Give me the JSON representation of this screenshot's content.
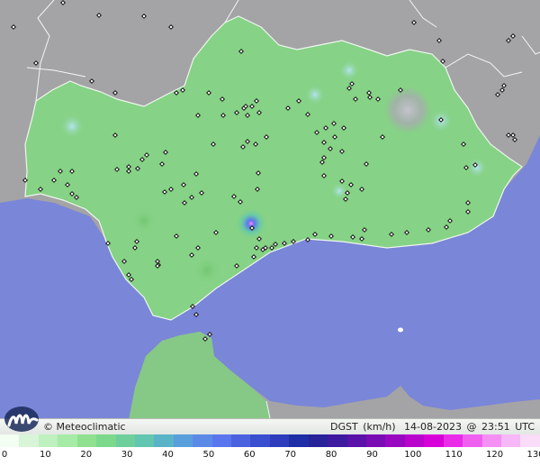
{
  "brand": {
    "copyright_symbol": "©",
    "name": "Meteoclimatic",
    "logo": "meteoclimatic-m-logo"
  },
  "info": {
    "variable": "DGST",
    "unit": "(km/h)",
    "date": "14-08-2023",
    "at": "@",
    "time": "23:51",
    "timezone": "UTC"
  },
  "legend": {
    "ticks": [
      "0",
      "10",
      "20",
      "30",
      "40",
      "50",
      "60",
      "70",
      "80",
      "90",
      "100",
      "110",
      "120",
      "130"
    ],
    "colors": [
      "#f2fff2",
      "#d8f5d8",
      "#bff0bf",
      "#a6eba6",
      "#8fe08f",
      "#7cd88c",
      "#6fcf9c",
      "#62c6b0",
      "#5ab4c8",
      "#589fdc",
      "#5a8ae6",
      "#5a76ee",
      "#4a62e0",
      "#3a4ed0",
      "#2c3cbc",
      "#1e2ea6",
      "#26229a",
      "#3e1aa0",
      "#5a12a8",
      "#7a0cb4",
      "#9808c0",
      "#b804cc",
      "#d800d8",
      "#ea2ce8",
      "#f060f0",
      "#f490f4",
      "#f6b8f6",
      "#f8dcf8"
    ]
  },
  "colors": {
    "sea": "#7a86d8",
    "land_outside": "#a4a4a6",
    "region": "#86d286",
    "morocco": "#86c886"
  },
  "map": {
    "region": "Andalucía",
    "layer": "wind-gust-contours",
    "station_marker": "diamond-marker"
  }
}
